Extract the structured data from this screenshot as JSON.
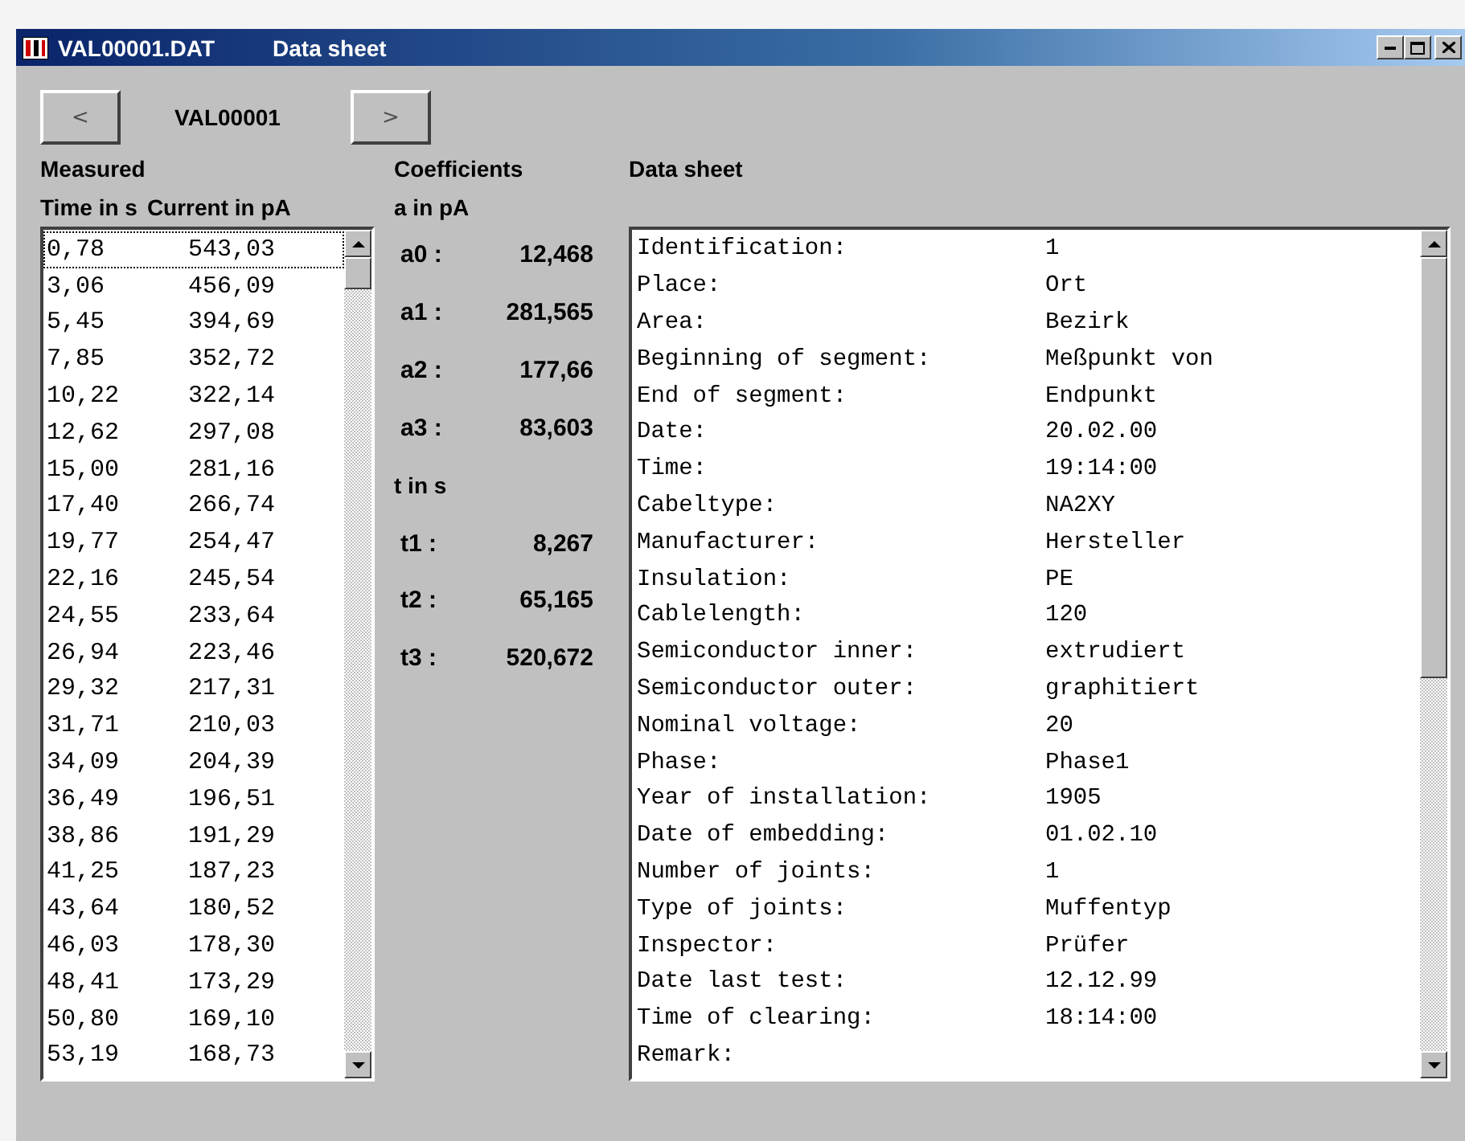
{
  "window": {
    "title": "VAL00001.DAT",
    "subtitle": "Data sheet"
  },
  "navigator": {
    "previous": "<",
    "record": "VAL00001",
    "next": ">"
  },
  "measured": {
    "title": "Measured",
    "columns": [
      "Time in s",
      "Current in pA"
    ],
    "rows": [
      {
        "time": "0,78",
        "current": "543,03",
        "focused": true
      },
      {
        "time": "3,06",
        "current": "456,09",
        "focused": false
      },
      {
        "time": "5,45",
        "current": "394,69",
        "focused": false
      },
      {
        "time": "7,85",
        "current": "352,72",
        "focused": false
      },
      {
        "time": "10,22",
        "current": "322,14",
        "focused": false
      },
      {
        "time": "12,62",
        "current": "297,08",
        "focused": false
      },
      {
        "time": "15,00",
        "current": "281,16",
        "focused": false
      },
      {
        "time": "17,40",
        "current": "266,74",
        "focused": false
      },
      {
        "time": "19,77",
        "current": "254,47",
        "focused": false
      },
      {
        "time": "22,16",
        "current": "245,54",
        "focused": false
      },
      {
        "time": "24,55",
        "current": "233,64",
        "focused": false
      },
      {
        "time": "26,94",
        "current": "223,46",
        "focused": false
      },
      {
        "time": "29,32",
        "current": "217,31",
        "focused": false
      },
      {
        "time": "31,71",
        "current": "210,03",
        "focused": false
      },
      {
        "time": "34,09",
        "current": "204,39",
        "focused": false
      },
      {
        "time": "36,49",
        "current": "196,51",
        "focused": false
      },
      {
        "time": "38,86",
        "current": "191,29",
        "focused": false
      },
      {
        "time": "41,25",
        "current": "187,23",
        "focused": false
      },
      {
        "time": "43,64",
        "current": "180,52",
        "focused": false
      },
      {
        "time": "46,03",
        "current": "178,30",
        "focused": false
      },
      {
        "time": "48,41",
        "current": "173,29",
        "focused": false
      },
      {
        "time": "50,80",
        "current": "169,10",
        "focused": false
      },
      {
        "time": "53,19",
        "current": "168,73",
        "focused": false
      }
    ]
  },
  "coefficients": {
    "title": "Coefficients",
    "unit": "a in pA",
    "a": [
      {
        "label": "a0 :",
        "value": "12,468"
      },
      {
        "label": "a1 :",
        "value": "281,565"
      },
      {
        "label": "a2 :",
        "value": "177,66"
      },
      {
        "label": "a3 :",
        "value": "83,603"
      }
    ],
    "t_unit": "t in s",
    "t": [
      {
        "label": "t1 :",
        "value": "8,267"
      },
      {
        "label": "t2 :",
        "value": "65,165"
      },
      {
        "label": "t3 :",
        "value": "520,672"
      }
    ]
  },
  "data_sheet": {
    "title": "Data sheet",
    "rows": [
      {
        "label": "Identification:",
        "value": "1"
      },
      {
        "label": "Place:",
        "value": "Ort"
      },
      {
        "label": "Area:",
        "value": "Bezirk"
      },
      {
        "label": "Beginning of segment:",
        "value": "Meßpunkt von"
      },
      {
        "label": "End of segment:",
        "value": "Endpunkt"
      },
      {
        "label": "Date:",
        "value": "20.02.00"
      },
      {
        "label": "Time:",
        "value": "19:14:00"
      },
      {
        "label": "Cabeltype:",
        "value": "NA2XY"
      },
      {
        "label": "Manufacturer:",
        "value": "Hersteller"
      },
      {
        "label": "Insulation:",
        "value": "PE"
      },
      {
        "label": "Cablelength:",
        "value": "120"
      },
      {
        "label": "Semiconductor inner:",
        "value": "extrudiert"
      },
      {
        "label": "Semiconductor outer:",
        "value": "graphitiert"
      },
      {
        "label": "Nominal voltage:",
        "value": "20"
      },
      {
        "label": "Phase:",
        "value": "Phase1"
      },
      {
        "label": "Year of installation:",
        "value": "1905"
      },
      {
        "label": "Date of embedding:",
        "value": "01.02.10"
      },
      {
        "label": "Number of joints:",
        "value": "1"
      },
      {
        "label": "Type of joints:",
        "value": "Muffentyp"
      },
      {
        "label": "Inspector:",
        "value": "Prüfer"
      },
      {
        "label": "Date last test:",
        "value": "12.12.99"
      },
      {
        "label": "Time of clearing:",
        "value": "18:14:00"
      },
      {
        "label": "Remark:"
      }
    ]
  }
}
